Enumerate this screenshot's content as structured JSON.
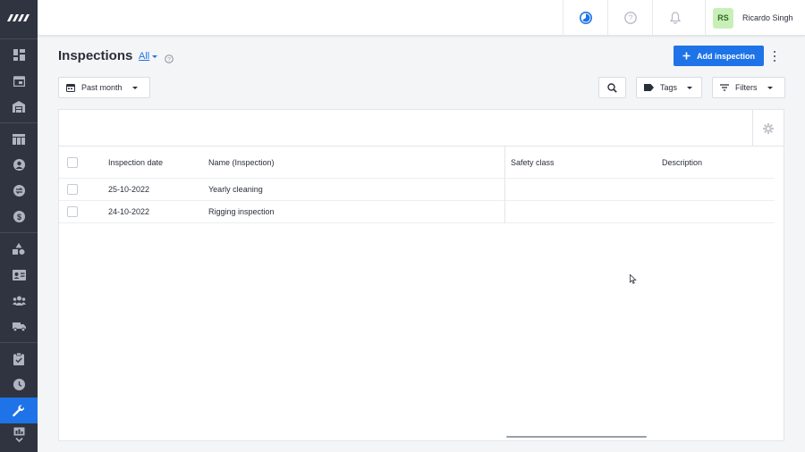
{
  "sidebar": {
    "logo": "brand-logo",
    "items": [
      {
        "name": "dashboard",
        "icon": "dashboard-icon"
      },
      {
        "name": "calendar",
        "icon": "calendar-icon"
      },
      {
        "name": "warehouse",
        "icon": "warehouse-icon"
      },
      {
        "name": "table",
        "icon": "table-icon"
      },
      {
        "name": "contacts",
        "icon": "person-icon"
      },
      {
        "name": "exchange",
        "icon": "exchange-icon"
      },
      {
        "name": "finance",
        "icon": "dollar-icon"
      },
      {
        "name": "inventory",
        "icon": "shapes-icon"
      },
      {
        "name": "crew",
        "icon": "id-card-icon"
      },
      {
        "name": "groups",
        "icon": "group-icon"
      },
      {
        "name": "transport",
        "icon": "truck-icon"
      },
      {
        "name": "tasks",
        "icon": "clipboard-check-icon"
      },
      {
        "name": "time",
        "icon": "clock-icon"
      },
      {
        "name": "maintenance",
        "icon": "wrench-icon",
        "active": true
      },
      {
        "name": "reports",
        "icon": "chart-icon"
      }
    ],
    "active_color": "#1e73e8",
    "bg_color": "#2f3440"
  },
  "topbar": {
    "icons": [
      "progress-icon",
      "help-icon",
      "bell-icon"
    ],
    "user": {
      "initials": "RS",
      "name": "Ricardo Singh"
    }
  },
  "header": {
    "title": "Inspections",
    "view_selector": "All",
    "add_button": "Add inspection"
  },
  "toolbar": {
    "date_filter": "Past month",
    "tags": "Tags",
    "filters": "Filters"
  },
  "table": {
    "columns": [
      "Inspection date",
      "Name (Inspection)",
      "Safety class",
      "Description"
    ],
    "rows": [
      {
        "date": "25-10-2022",
        "name": "Yearly cleaning",
        "safety_class": "",
        "description": ""
      },
      {
        "date": "24-10-2022",
        "name": "Rigging inspection",
        "safety_class": "",
        "description": ""
      }
    ]
  }
}
